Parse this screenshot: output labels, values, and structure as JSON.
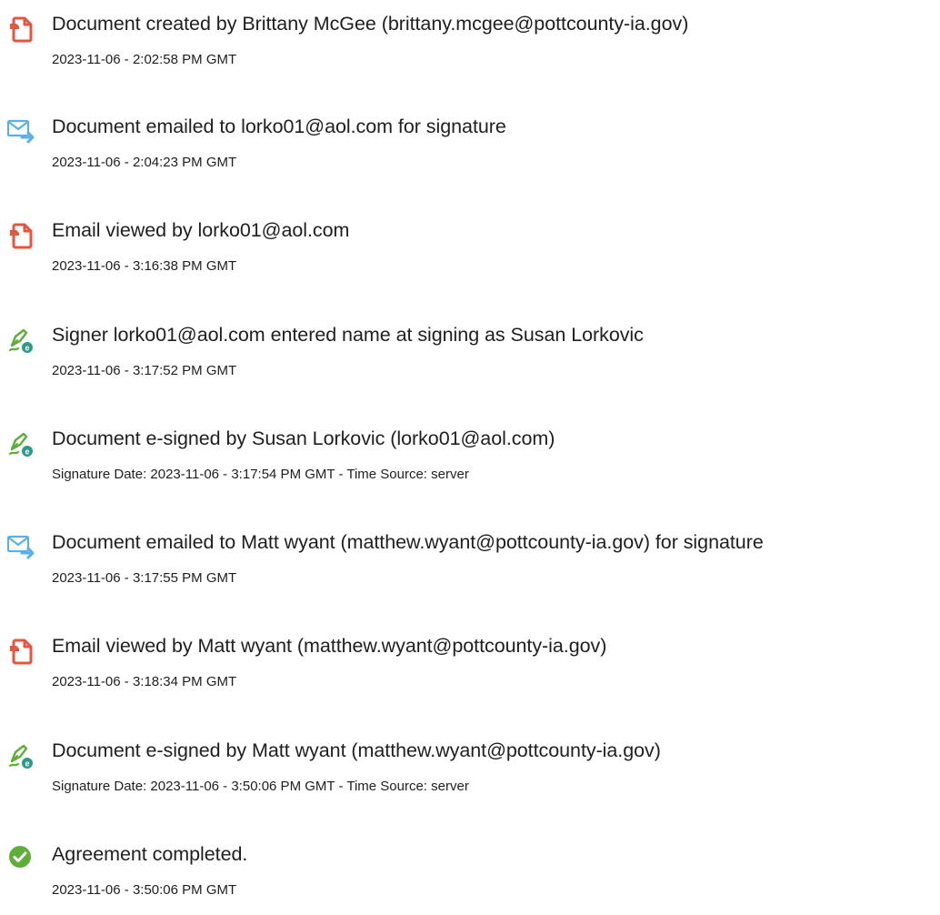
{
  "events": [
    {
      "icon": "document-created-icon",
      "title": "Document created by Brittany McGee (brittany.mcgee@pottcounty-ia.gov)",
      "detail": "2023-11-06 - 2:02:58 PM GMT"
    },
    {
      "icon": "email-sent-icon",
      "title": "Document emailed to lorko01@aol.com for signature",
      "detail": "2023-11-06 - 2:04:23 PM GMT"
    },
    {
      "icon": "document-viewed-icon",
      "title": "Email viewed by lorko01@aol.com",
      "detail": "2023-11-06 - 3:16:38 PM GMT"
    },
    {
      "icon": "signature-pen-icon",
      "title": "Signer lorko01@aol.com entered name at signing as Susan Lorkovic",
      "detail": "2023-11-06 - 3:17:52 PM GMT"
    },
    {
      "icon": "signature-pen-icon",
      "title": "Document e-signed by Susan Lorkovic (lorko01@aol.com)",
      "detail": "Signature Date: 2023-11-06 - 3:17:54 PM GMT - Time Source: server"
    },
    {
      "icon": "email-sent-icon",
      "title": "Document emailed to Matt wyant (matthew.wyant@pottcounty-ia.gov) for signature",
      "detail": "2023-11-06 - 3:17:55 PM GMT"
    },
    {
      "icon": "document-viewed-icon",
      "title": "Email viewed by Matt wyant (matthew.wyant@pottcounty-ia.gov)",
      "detail": "2023-11-06 - 3:18:34 PM GMT"
    },
    {
      "icon": "signature-pen-icon",
      "title": "Document e-signed by Matt wyant (matthew.wyant@pottcounty-ia.gov)",
      "detail": "Signature Date: 2023-11-06 - 3:50:06 PM GMT - Time Source: server"
    },
    {
      "icon": "checkmark-circle-icon",
      "title": "Agreement completed.",
      "detail": "2023-11-06 - 3:50:06 PM GMT"
    }
  ],
  "colors": {
    "document_icon": "#e8553e",
    "email_icon": "#5ab0e8",
    "pen_icon": "#5fae3a",
    "pen_badge": "#2e9a8a",
    "check_circle": "#5fae3a",
    "text": "#1f1f1f"
  }
}
